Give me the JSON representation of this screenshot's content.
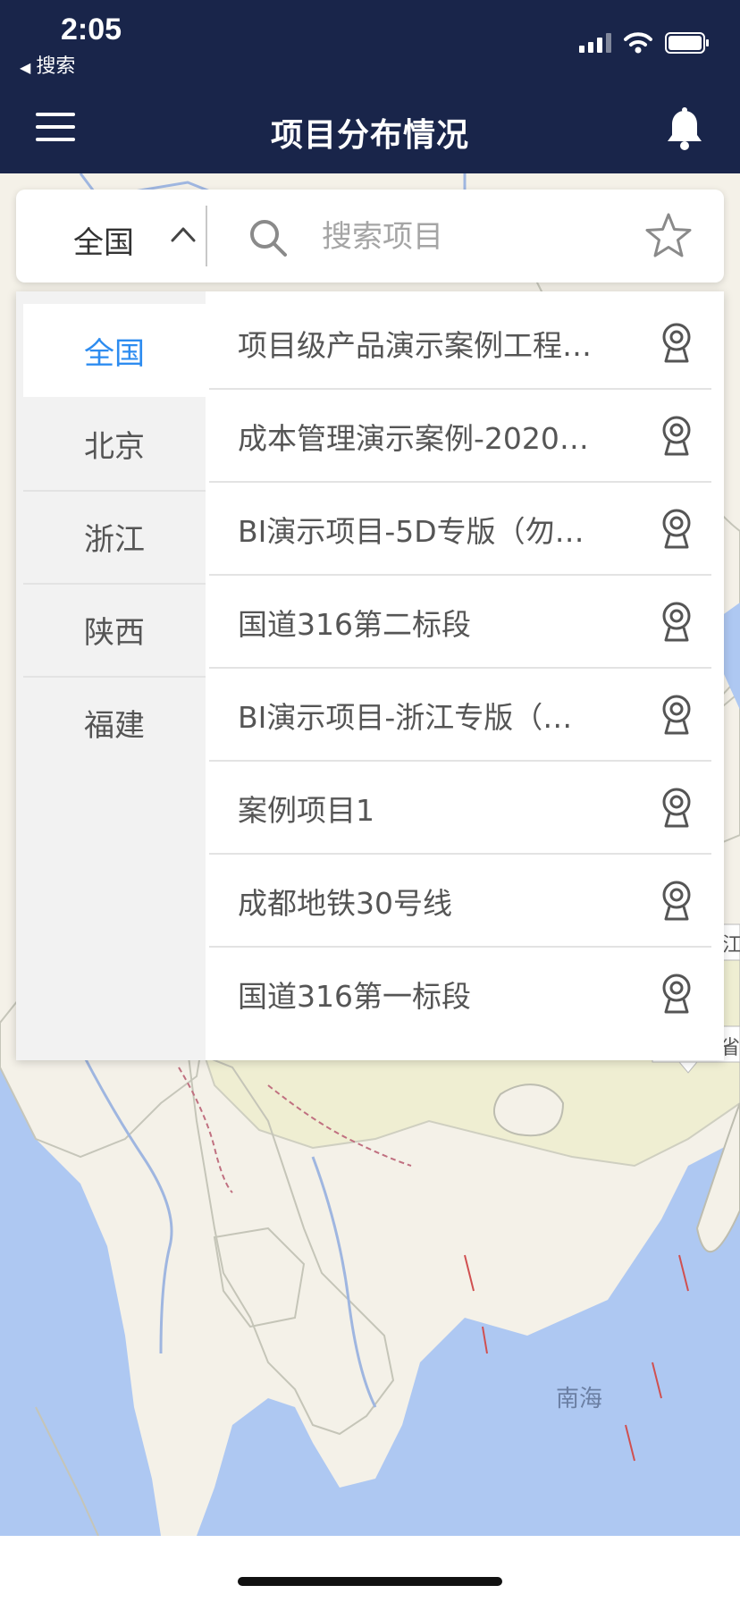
{
  "status_bar": {
    "time": "2:05",
    "back_app": "搜索",
    "icons": [
      "signal-icon",
      "wifi-icon",
      "battery-icon"
    ]
  },
  "nav": {
    "title": "项目分布情况",
    "menu_icon": "menu-icon",
    "bell_icon": "bell-icon"
  },
  "search": {
    "region": "全国",
    "placeholder": "搜索项目"
  },
  "regions": [
    {
      "label": "全国",
      "active": true
    },
    {
      "label": "北京",
      "active": false
    },
    {
      "label": "浙江",
      "active": false
    },
    {
      "label": "陕西",
      "active": false
    },
    {
      "label": "福建",
      "active": false
    }
  ],
  "projects": [
    {
      "label": "项目级产品演示案例工程…"
    },
    {
      "label": "成本管理演示案例-2020…"
    },
    {
      "label": "BI演示项目-5D专版（勿…"
    },
    {
      "label": "国道316第二标段"
    },
    {
      "label": "BI演示项目-浙江专版（…"
    },
    {
      "label": "案例项目1"
    },
    {
      "label": "成都地铁30号线"
    },
    {
      "label": "国道316第一标段"
    }
  ],
  "map": {
    "sea_label": "南海",
    "edge_label_1": "江省",
    "edge_label_2": "省",
    "colors": {
      "land": "#f4f1e8",
      "sea": "#aec8f2",
      "province": "#efeed2",
      "header": "#19254a",
      "accent": "#2d8cf0"
    }
  }
}
